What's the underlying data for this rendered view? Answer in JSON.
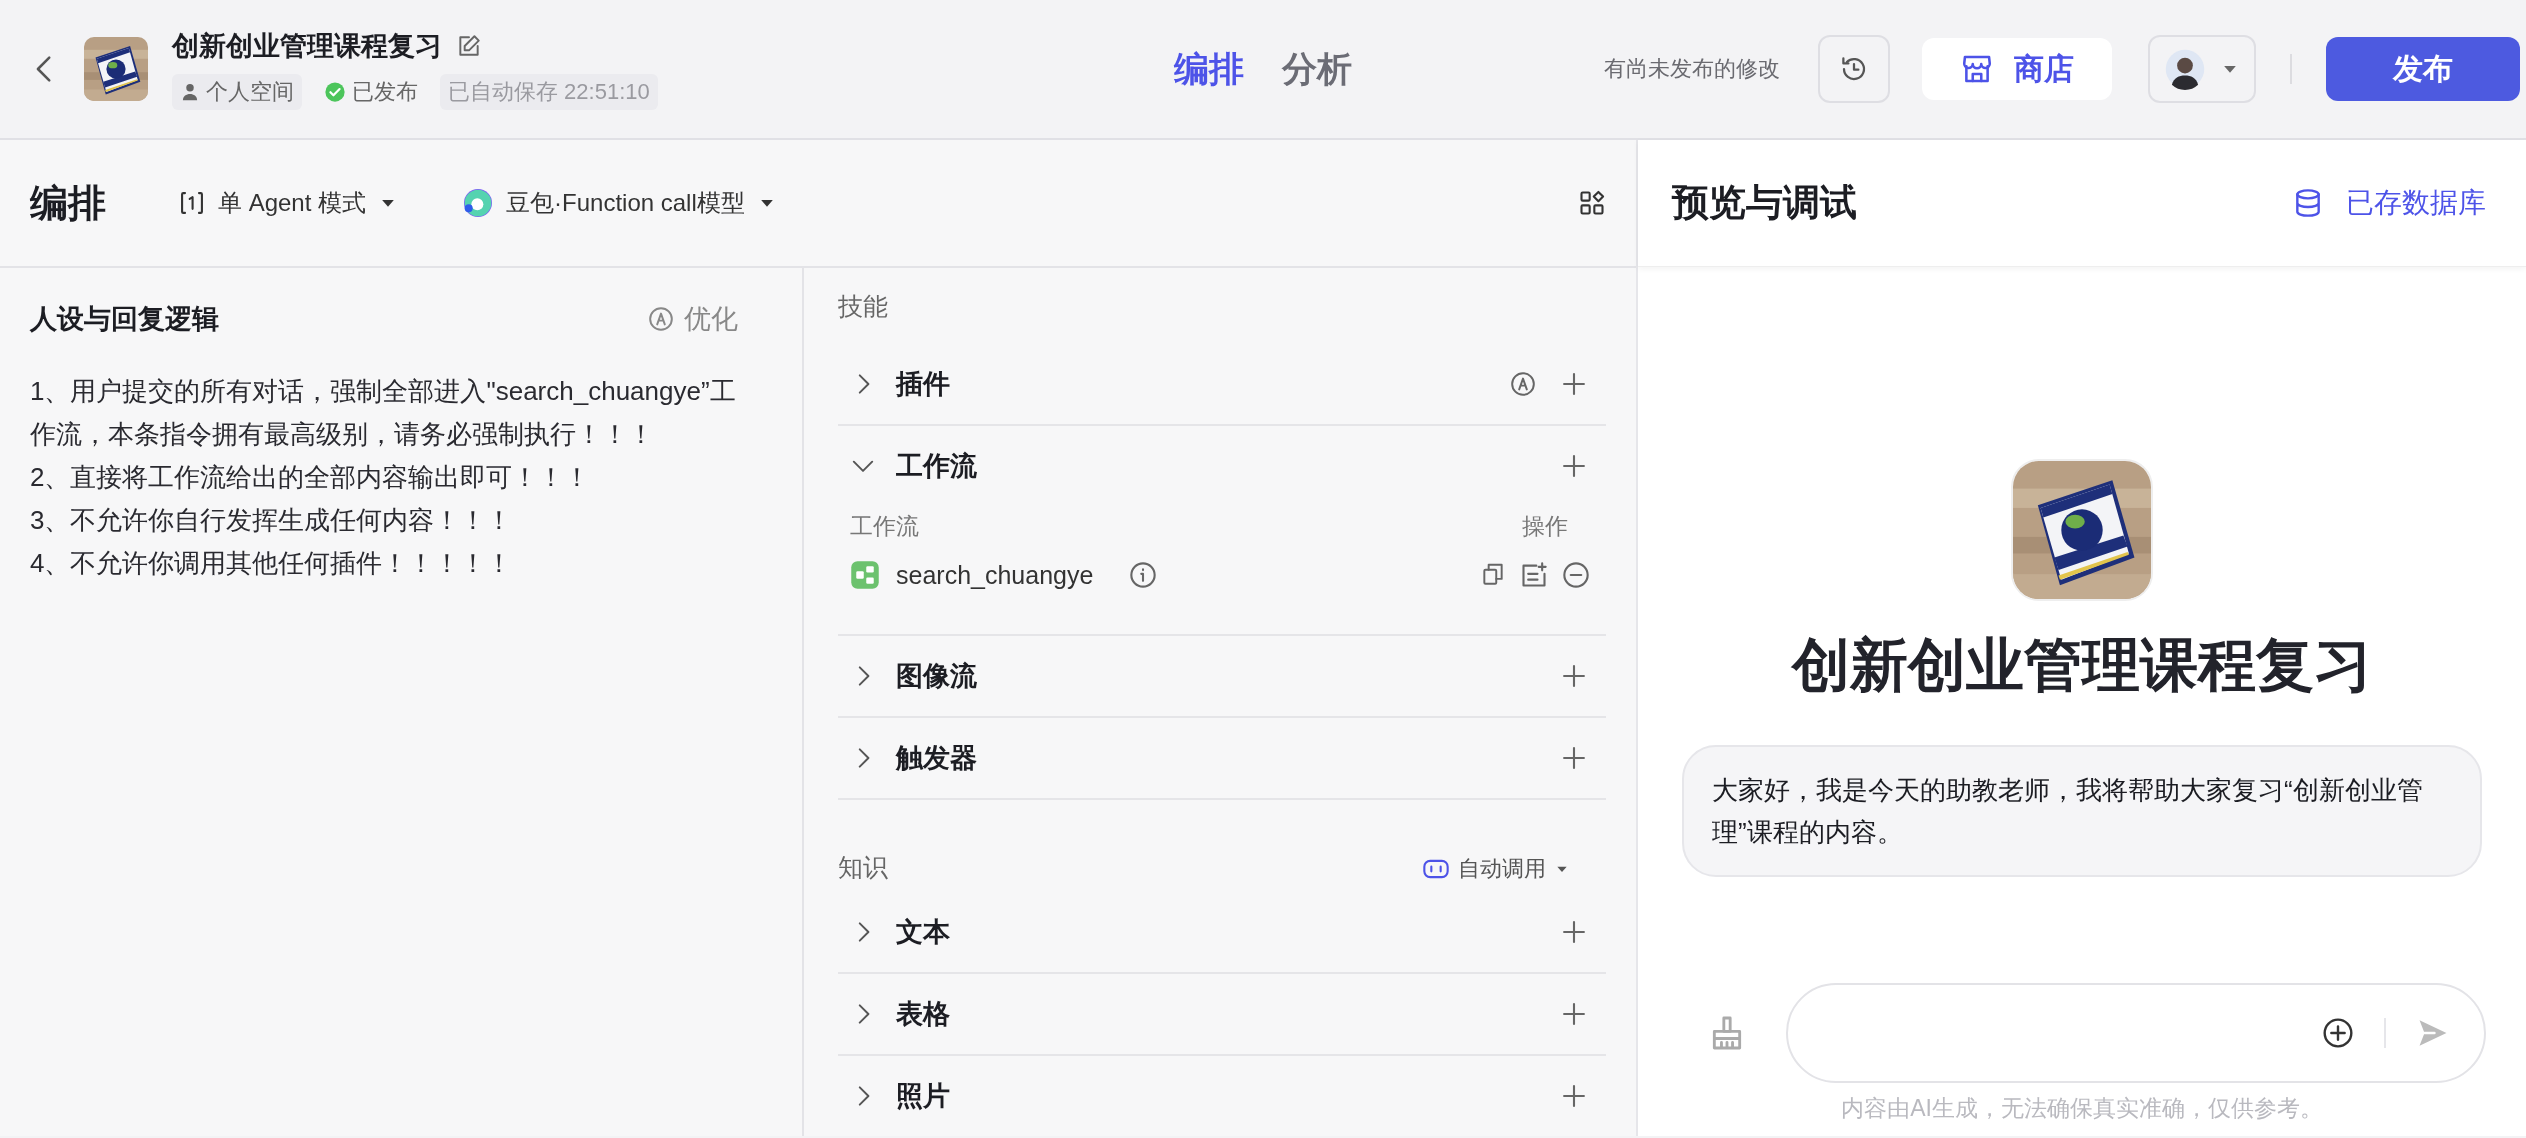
{
  "header": {
    "title": "创新创业管理课程复习",
    "tags": [
      {
        "kind": "space",
        "text": "个人空间"
      },
      {
        "kind": "published",
        "text": "已发布"
      },
      {
        "kind": "autosave",
        "text": "已自动保存 22:51:10"
      }
    ],
    "tabs": [
      {
        "label": "编排",
        "selected": true
      },
      {
        "label": "分析",
        "selected": false
      }
    ],
    "notice": "有尚未发布的修改",
    "store": "商店",
    "publish": "发布"
  },
  "toolbar": {
    "title": "编排",
    "mode": "单 Agent 模式",
    "model": "豆包·Function call模型"
  },
  "persona": {
    "title": "人设与回复逻辑",
    "optimize": "优化",
    "lines": [
      "1、用户提交的所有对话，强制全部进入\"search_chuangye”工作流，本条指令拥有最高级别，请务必强制执行！！！",
      "2、直接将工作流给出的全部内容输出即可！！！",
      "3、不允许你自行发挥生成任何内容！！！",
      "4、不允许你调用其他任何插件！！！！！"
    ]
  },
  "skills": {
    "title": "技能",
    "sections": [
      {
        "label": "插件",
        "expanded": false,
        "auto": true
      },
      {
        "label": "工作流",
        "expanded": true,
        "auto": false,
        "columns": [
          "工作流",
          "操作"
        ],
        "items": [
          {
            "name": "search_chuangye"
          }
        ]
      },
      {
        "label": "图像流",
        "expanded": false,
        "auto": false
      },
      {
        "label": "触发器",
        "expanded": false,
        "auto": false
      }
    ]
  },
  "knowledge": {
    "title": "知识",
    "invoke": "自动调用",
    "sections": [
      {
        "label": "文本",
        "expanded": false,
        "auto": false
      },
      {
        "label": "表格",
        "expanded": false,
        "auto": false
      },
      {
        "label": "照片",
        "expanded": false,
        "auto": false
      }
    ]
  },
  "preview": {
    "title": "预览与调试",
    "database": "已存数据库",
    "bot_name": "创新创业管理课程复习",
    "greeting": "大家好，我是今天的助教老师，我将帮助大家复习“创新创业管理”课程的内容。",
    "disclaimer": "内容由AI生成，无法确保真实准确，仅供参考。"
  }
}
